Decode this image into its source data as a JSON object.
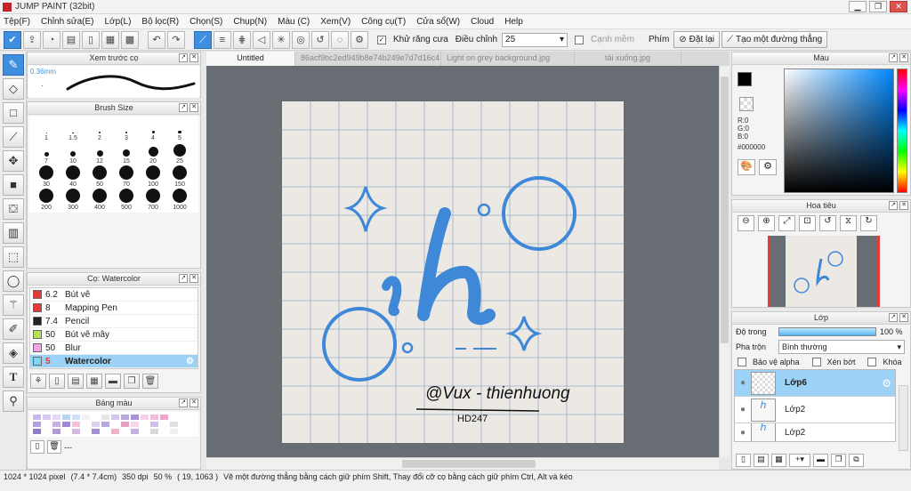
{
  "window": {
    "title": "JUMP PAINT (32bit)",
    "min": "▁",
    "restore": "❐",
    "close": "✕"
  },
  "menu": [
    "Tệp(F)",
    "Chỉnh sửa(E)",
    "Lớp(L)",
    "Bộ lọc(R)",
    "Chọn(S)",
    "Chụp(N)",
    "Màu (C)",
    "Xem(V)",
    "Công cụ(T)",
    "Cửa sổ(W)",
    "Cloud",
    "Help"
  ],
  "toolbar": {
    "antialias_label": "Khử răng cưa",
    "adjust_label": "Điều chỉnh",
    "adjust_value": "25",
    "sharpen_label": "Cạnh mềm",
    "key_label": "Phím",
    "reset_label": "Đặt lại",
    "line_label": "Tạo một đường thẳng"
  },
  "brush_preview": {
    "title": "Xem trước cọ",
    "size": "0.36mm"
  },
  "brush_size": {
    "title": "Brush Size",
    "sizes": [
      "1",
      "1.5",
      "2",
      "3",
      "4",
      "5",
      "7",
      "10",
      "12",
      "15",
      "20",
      "25",
      "30",
      "40",
      "50",
      "70",
      "100",
      "150",
      "200",
      "300",
      "400",
      "500",
      "700",
      "1000"
    ]
  },
  "brush_list": {
    "title": "Cọ: Watercolor",
    "items": [
      {
        "num": "6.2",
        "name": "Bút vẽ",
        "color": "#e53935"
      },
      {
        "num": "8",
        "name": "Mapping Pen",
        "color": "#e53935"
      },
      {
        "num": "7.4",
        "name": "Pencil",
        "color": "#222222"
      },
      {
        "num": "50",
        "name": "Bút vẽ mây",
        "color": "#b6e35a"
      },
      {
        "num": "50",
        "name": "Blur",
        "color": "#f4a3e8"
      },
      {
        "num": "5",
        "name": "Watercolor",
        "color": "#7fd6f3"
      }
    ]
  },
  "palette": {
    "title": "Bảng màu",
    "footer": "---"
  },
  "tabs": [
    "Untitled",
    "86acf9bc2ed949b8e74b249e7d7d16c4.jpg",
    "Light on grey background.jpg",
    "tải xuống.jpg"
  ],
  "artwork": {
    "signature": "@Vux - thienhuong",
    "code": "HD247"
  },
  "color_panel": {
    "title": "Màu",
    "r": "R:0",
    "g": "G:0",
    "b": "B:0",
    "hex": "#000000"
  },
  "navigator": {
    "title": "Hoa tiêu"
  },
  "layers": {
    "title": "Lớp",
    "opacity_label": "Độ trong",
    "opacity_value": "100 %",
    "opacity_level": 100,
    "blend_label": "Pha trộn",
    "blend_value": "Bình thường",
    "protect_alpha": "Bảo vệ alpha",
    "clip": "Xén bớt",
    "lock": "Khóa",
    "items": [
      "Lớp6",
      "Lớp2",
      "Lớp2"
    ]
  },
  "status": {
    "size": "1024 * 1024 pixel",
    "cm": "(7.4 * 7.4cm)",
    "dpi": "350 dpi",
    "zoom": "50 %",
    "coords": "( 19, 1063 )",
    "hint": "Vẽ một đường thẳng bằng cách giữ phím Shift, Thay đổi cỡ cọ bằng cách giữ phím Ctrl, Alt và kéo"
  },
  "colors": {
    "accent": "#3e8fe0",
    "selected_row": "#9bd2f6",
    "canvas_bg": "#686d73",
    "art_blue": "#3f88d8"
  }
}
